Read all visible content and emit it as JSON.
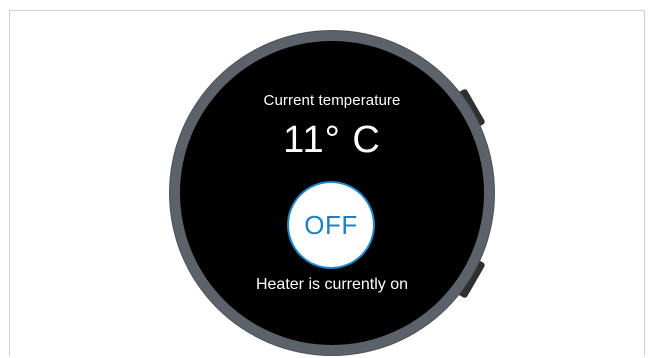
{
  "watch": {
    "current_temperature_label": "Current temperature",
    "temperature": "11° C",
    "toggle_label": "OFF",
    "status_text": "Heater is currently on"
  },
  "colors": {
    "face": "#000000",
    "bezel": "#5c6269",
    "accent": "#1e88c8",
    "text": "#ffffff"
  }
}
